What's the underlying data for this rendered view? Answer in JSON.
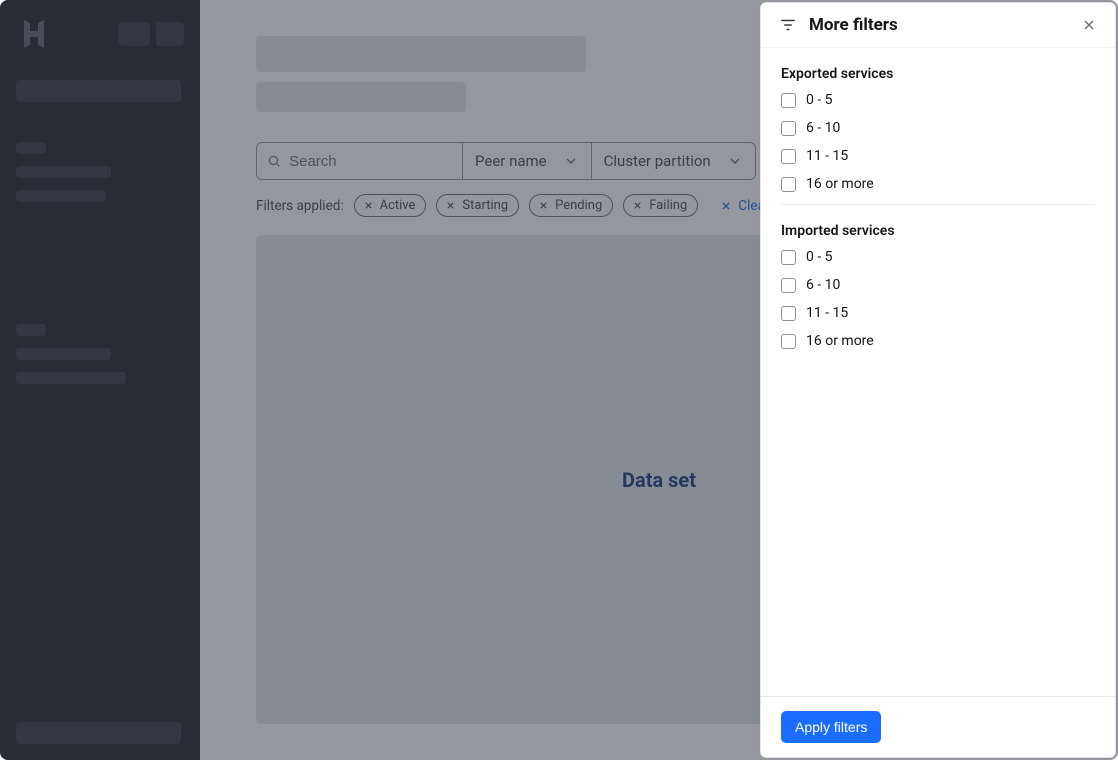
{
  "search": {
    "placeholder": "Search"
  },
  "dropdowns": {
    "peer": "Peer name",
    "cluster": "Cluster partition"
  },
  "tags": {
    "label": "Filters applied:",
    "items": [
      "Active",
      "Starting",
      "Pending",
      "Failing"
    ],
    "clear": "Clear filters"
  },
  "content": {
    "label": "Data set"
  },
  "panel": {
    "title": "More filters",
    "exported": {
      "title": "Exported services",
      "options": [
        "0 - 5",
        "6 - 10",
        "11 - 15",
        "16 or more"
      ]
    },
    "imported": {
      "title": "Imported services",
      "options": [
        "0 - 5",
        "6 - 10",
        "11 - 15",
        "16 or more"
      ]
    },
    "apply": "Apply filters"
  }
}
